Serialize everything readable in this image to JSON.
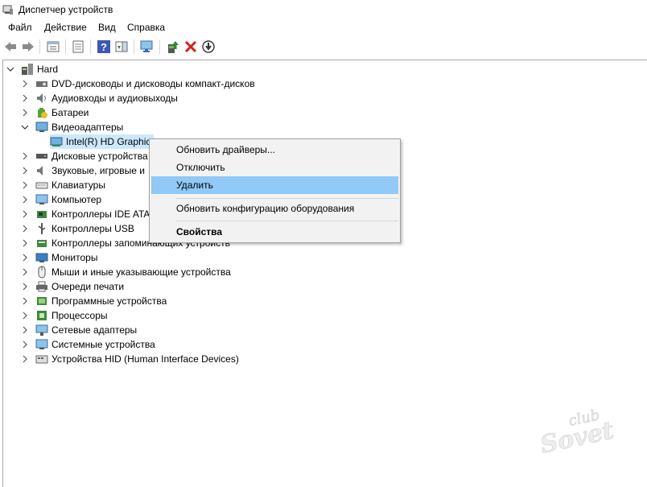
{
  "window": {
    "title": "Диспетчер устройств"
  },
  "menubar": {
    "items": [
      "Файл",
      "Действие",
      "Вид",
      "Справка"
    ]
  },
  "tree": {
    "root": "Hard",
    "items": [
      "DVD-дисководы и дисководы компакт-дисков",
      "Аудиовходы и аудиовыходы",
      "Батареи",
      "Видеоадаптеры",
      "Intel(R) HD Graphic",
      "Дисковые устройства",
      "Звуковые, игровые и",
      "Клавиатуры",
      "Компьютер",
      "Контроллеры IDE ATA",
      "Контроллеры USB",
      "Контроллеры запоминающих устройств",
      "Мониторы",
      "Мыши и иные указывающие устройства",
      "Очереди печати",
      "Программные устройства",
      "Процессоры",
      "Сетевые адаптеры",
      "Системные устройства",
      "Устройства HID (Human Interface Devices)"
    ]
  },
  "context_menu": {
    "items": [
      "Обновить драйверы...",
      "Отключить",
      "Удалить",
      "Обновить конфигурацию оборудования",
      "Свойства"
    ]
  },
  "watermark": {
    "text": "club Sovet"
  }
}
